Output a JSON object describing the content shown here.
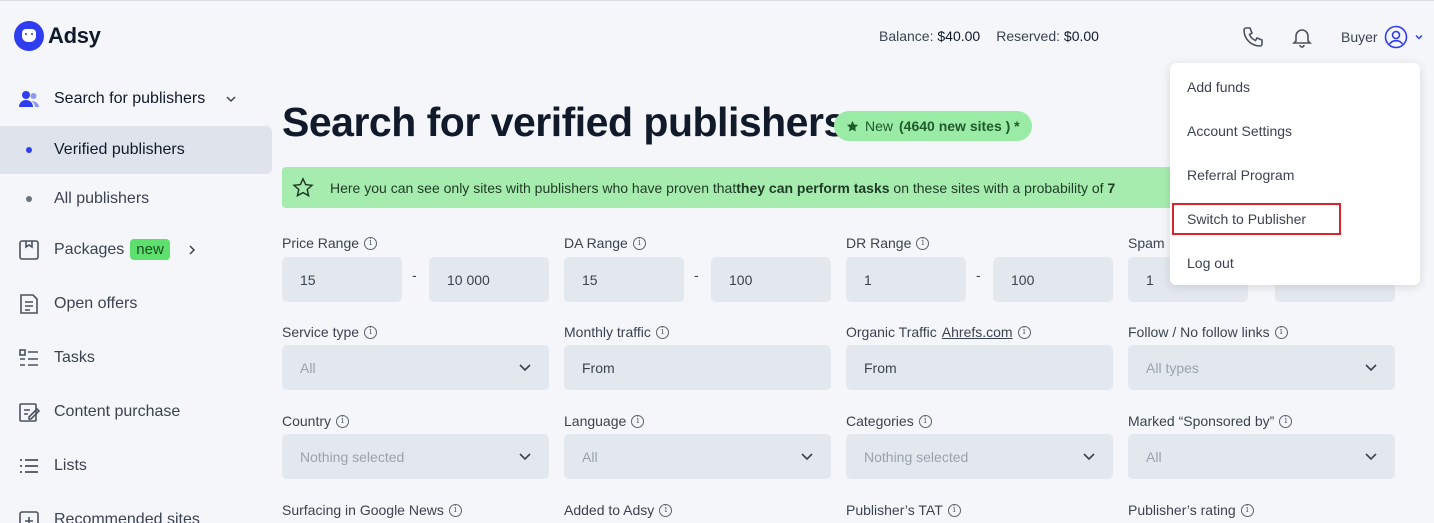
{
  "header": {
    "logo_text": "Adsy",
    "balance_label": "Balance:",
    "balance_value": "$40.00",
    "reserved_label": "Reserved:",
    "reserved_value": "$0.00",
    "user_role": "Buyer"
  },
  "sidebar": {
    "items": [
      {
        "label": "Search for publishers",
        "icon": "users-icon"
      },
      {
        "label": "Verified publishers"
      },
      {
        "label": "All publishers"
      },
      {
        "label": "Packages",
        "badge": "new",
        "icon": "package-icon"
      },
      {
        "label": "Open offers",
        "icon": "document-icon"
      },
      {
        "label": "Tasks",
        "icon": "tasks-icon"
      },
      {
        "label": "Content purchase",
        "icon": "edit-icon"
      },
      {
        "label": "Lists",
        "icon": "list-icon"
      },
      {
        "label": "Recommended sites",
        "icon": "recommended-icon"
      }
    ]
  },
  "main": {
    "title": "Search for verified publishers",
    "new_pill_prefix": "New",
    "new_pill_count": "(4640 new sites ) *",
    "info_text_before": "Here you can see only sites with publishers who have proven that ",
    "info_text_bold": "they can perform tasks",
    "info_text_after": " on these sites with a probability of ",
    "info_text_tail": "7"
  },
  "filters": {
    "price_range": {
      "label": "Price Range",
      "from": "15",
      "to": "10 000"
    },
    "da_range": {
      "label": "DA Range",
      "from": "15",
      "to": "100"
    },
    "dr_range": {
      "label": "DR Range",
      "from": "1",
      "to": "100"
    },
    "spam": {
      "label": "Spam",
      "from": "1"
    },
    "range_separator": "-",
    "service_type": {
      "label": "Service type",
      "value": "All"
    },
    "monthly_traffic": {
      "label": "Monthly traffic",
      "placeholder": "From"
    },
    "organic_traffic": {
      "label": "Organic Traffic",
      "link": "Ahrefs.com",
      "placeholder": "From"
    },
    "follow_links": {
      "label": "Follow / No follow links",
      "value": "All types"
    },
    "country": {
      "label": "Country",
      "value": "Nothing selected"
    },
    "language": {
      "label": "Language",
      "value": "All"
    },
    "categories": {
      "label": "Categories",
      "value": "Nothing selected"
    },
    "sponsored": {
      "label": "Marked “Sponsored by”",
      "value": "All"
    },
    "google_news": {
      "label": "Surfacing in Google News"
    },
    "added_to_adsy": {
      "label": "Added to Adsy"
    },
    "publisher_tat": {
      "label": "Publisher’s TAT"
    },
    "publisher_rating": {
      "label": "Publisher’s rating"
    }
  },
  "user_menu": {
    "items": [
      "Add funds",
      "Account Settings",
      "Referral Program",
      "Switch to Publisher",
      "Log out"
    ]
  },
  "colors": {
    "accent": "#2f3df0",
    "green_badge": "#5ee06e",
    "info_bar": "#a6ecae",
    "highlight": "#d8242a"
  }
}
